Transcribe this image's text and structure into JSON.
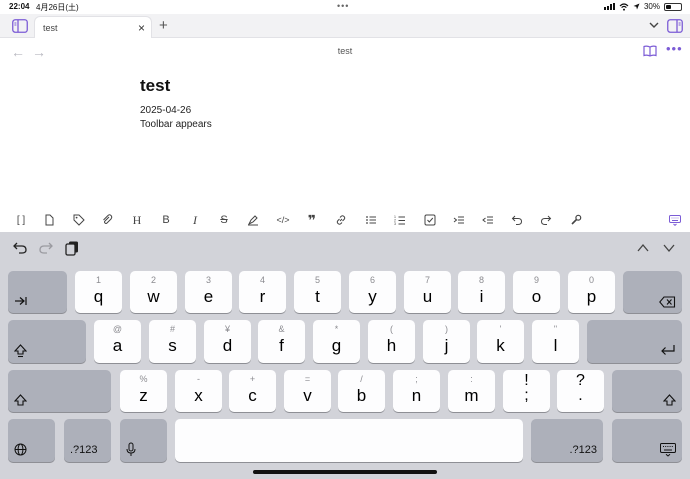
{
  "status": {
    "time": "22:04",
    "date": "4月26日(土)",
    "battery": "30%"
  },
  "tabs": [
    {
      "label": "test"
    }
  ],
  "nav": {
    "title": "test"
  },
  "note": {
    "title": "test",
    "lines": [
      "2025-04-26",
      "Toolbar appears"
    ]
  },
  "toolbar": {
    "items": [
      "brackets-icon",
      "file-icon",
      "tag-icon",
      "attachment-icon",
      "heading-icon",
      "bold-icon",
      "italic-icon",
      "strikethrough-icon",
      "highlight-icon",
      "code-icon",
      "quote-icon",
      "link-icon",
      "bullet-list-icon",
      "numbered-list-icon",
      "checkbox-icon",
      "indent-icon",
      "outdent-icon",
      "undo-icon",
      "redo-icon",
      "wrench-icon",
      "keyboard-dismiss-icon"
    ],
    "accent": "#7c5cd6"
  },
  "keyboard": {
    "row1": [
      {
        "k": "q",
        "s": "1"
      },
      {
        "k": "w",
        "s": "2"
      },
      {
        "k": "e",
        "s": "3"
      },
      {
        "k": "r",
        "s": "4"
      },
      {
        "k": "t",
        "s": "5"
      },
      {
        "k": "y",
        "s": "6"
      },
      {
        "k": "u",
        "s": "7"
      },
      {
        "k": "i",
        "s": "8"
      },
      {
        "k": "o",
        "s": "9"
      },
      {
        "k": "p",
        "s": "0"
      }
    ],
    "row2": [
      {
        "k": "a",
        "s": "@"
      },
      {
        "k": "s",
        "s": "#"
      },
      {
        "k": "d",
        "s": "¥"
      },
      {
        "k": "f",
        "s": "&"
      },
      {
        "k": "g",
        "s": "*"
      },
      {
        "k": "h",
        "s": "("
      },
      {
        "k": "j",
        "s": ")"
      },
      {
        "k": "k",
        "s": "'"
      },
      {
        "k": "l",
        "s": "\""
      }
    ],
    "row3": [
      {
        "k": "z",
        "s": "%"
      },
      {
        "k": "x",
        "s": "-"
      },
      {
        "k": "c",
        "s": "+"
      },
      {
        "k": "v",
        "s": "="
      },
      {
        "k": "b",
        "s": "/"
      },
      {
        "k": "n",
        "s": ";"
      },
      {
        "k": "m",
        "s": ":"
      }
    ],
    "punct": [
      {
        "k": ";",
        "s": "!"
      },
      {
        "k": ".",
        "s": "?"
      }
    ],
    "num_label": ".?123"
  }
}
